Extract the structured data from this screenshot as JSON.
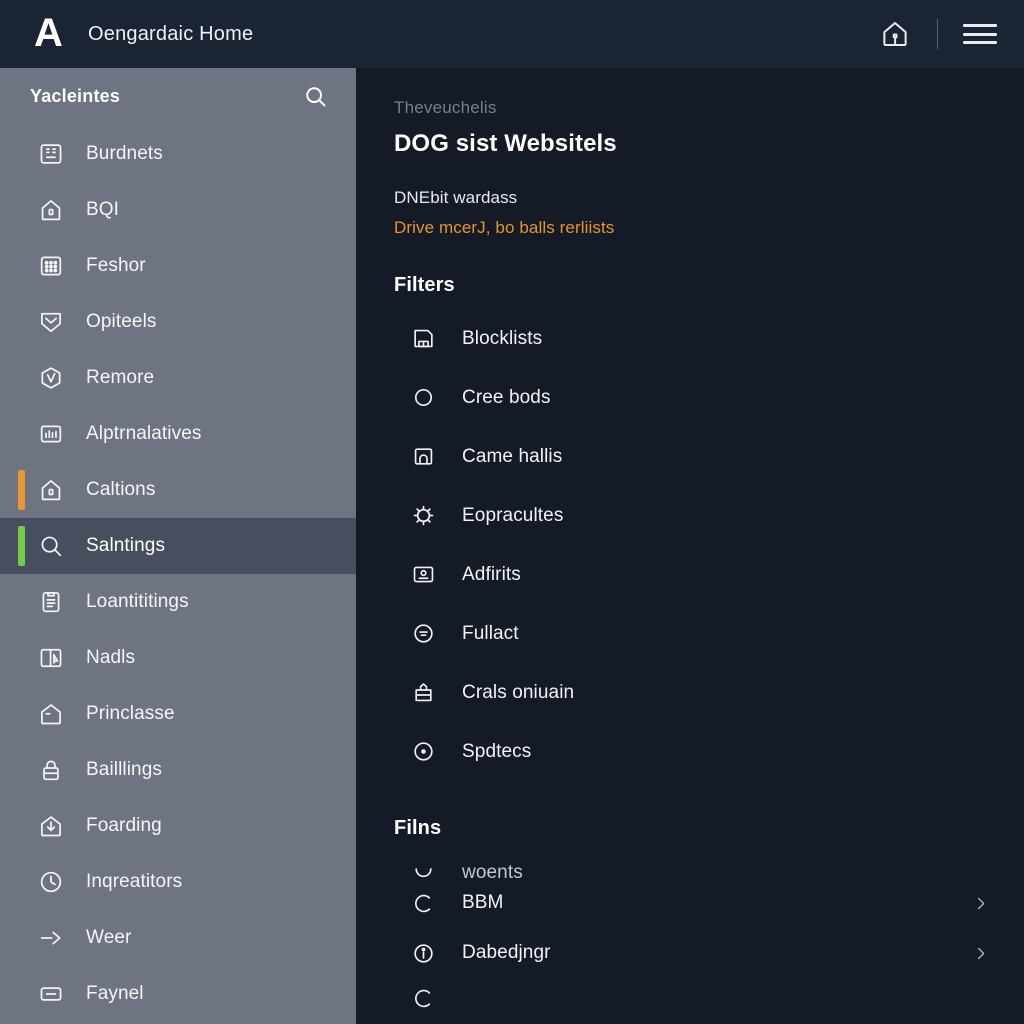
{
  "topbar": {
    "logo_letter": "A",
    "title": "Oengardaic Home",
    "home_icon": "home-icon",
    "menu_icon": "hamburger-menu-icon"
  },
  "sidebar": {
    "header": "Yacleintes",
    "search_icon": "search-icon",
    "accent_orange": "#e8972e",
    "accent_green": "#78c850",
    "background": "#6e7482",
    "selected_background": "#474e5d",
    "items": [
      {
        "label": "Burdnets",
        "icon": "layout-panels-icon",
        "accent": "none",
        "selected": false
      },
      {
        "label": "BQI",
        "icon": "house-lock-icon",
        "accent": "none",
        "selected": false
      },
      {
        "label": "Feshor",
        "icon": "grid-keypad-icon",
        "accent": "none",
        "selected": false
      },
      {
        "label": "Opiteels",
        "icon": "shield-check-icon",
        "accent": "none",
        "selected": false
      },
      {
        "label": "Remore",
        "icon": "hexagon-check-icon",
        "accent": "none",
        "selected": false
      },
      {
        "label": "Alptrnalatives",
        "icon": "chart-bars-icon",
        "accent": "none",
        "selected": false
      },
      {
        "label": "Caltions",
        "icon": "house-lock-icon",
        "accent": "orange",
        "selected": false
      },
      {
        "label": "Salntings",
        "icon": "search-icon",
        "accent": "green",
        "selected": true
      },
      {
        "label": "Loantititings",
        "icon": "clipboard-list-icon",
        "accent": "none",
        "selected": false
      },
      {
        "label": "Nadls",
        "icon": "window-cursor-icon",
        "accent": "none",
        "selected": false
      },
      {
        "label": "Princlasse",
        "icon": "envelope-open-icon",
        "accent": "none",
        "selected": false
      },
      {
        "label": "Bailllings",
        "icon": "lock-icon",
        "accent": "none",
        "selected": false
      },
      {
        "label": "Foarding",
        "icon": "download-icon",
        "accent": "none",
        "selected": false
      },
      {
        "label": "Inqreatitors",
        "icon": "clock-icon",
        "accent": "none",
        "selected": false
      },
      {
        "label": "Weer",
        "icon": "send-arrow-icon",
        "accent": "none",
        "selected": false
      },
      {
        "label": "Faynel",
        "icon": "minus-box-icon",
        "accent": "none",
        "selected": false
      }
    ]
  },
  "main": {
    "breadcrumb": "Theveuchelis",
    "title": "DOG sist Websitels",
    "description": "DNEbit wardass",
    "link_text": "Drive mcerJ, bo balls rerliists",
    "link_color": "#e8942a",
    "background": "#141a26",
    "filters": {
      "heading": "Filters",
      "items": [
        {
          "label": "Blocklists",
          "icon": "floppy-save-icon"
        },
        {
          "label": "Cree bods",
          "icon": "circle-icon"
        },
        {
          "label": "Came hallis",
          "icon": "arch-bookmark-icon"
        },
        {
          "label": "Eopracultes",
          "icon": "gear-sun-icon"
        },
        {
          "label": "Adfirits",
          "icon": "id-card-icon"
        },
        {
          "label": "Fullact",
          "icon": "circle-dash-icon"
        },
        {
          "label": "Crals oniuain",
          "icon": "envelope-tag-icon"
        },
        {
          "label": "Spdtecs",
          "icon": "circle-dot-icon"
        }
      ]
    },
    "films": {
      "heading": "Filns",
      "items": [
        {
          "label": "woents",
          "icon": "arc-icon",
          "chevron": false,
          "clip": "top"
        },
        {
          "label": "BBM",
          "icon": "circle-open-icon",
          "chevron": true,
          "clip": "none"
        },
        {
          "label": "Dabedjngr",
          "icon": "info-circle-icon",
          "chevron": true,
          "clip": "none"
        },
        {
          "label": "",
          "icon": "circle-open-icon",
          "chevron": false,
          "clip": "bottom"
        }
      ]
    }
  }
}
